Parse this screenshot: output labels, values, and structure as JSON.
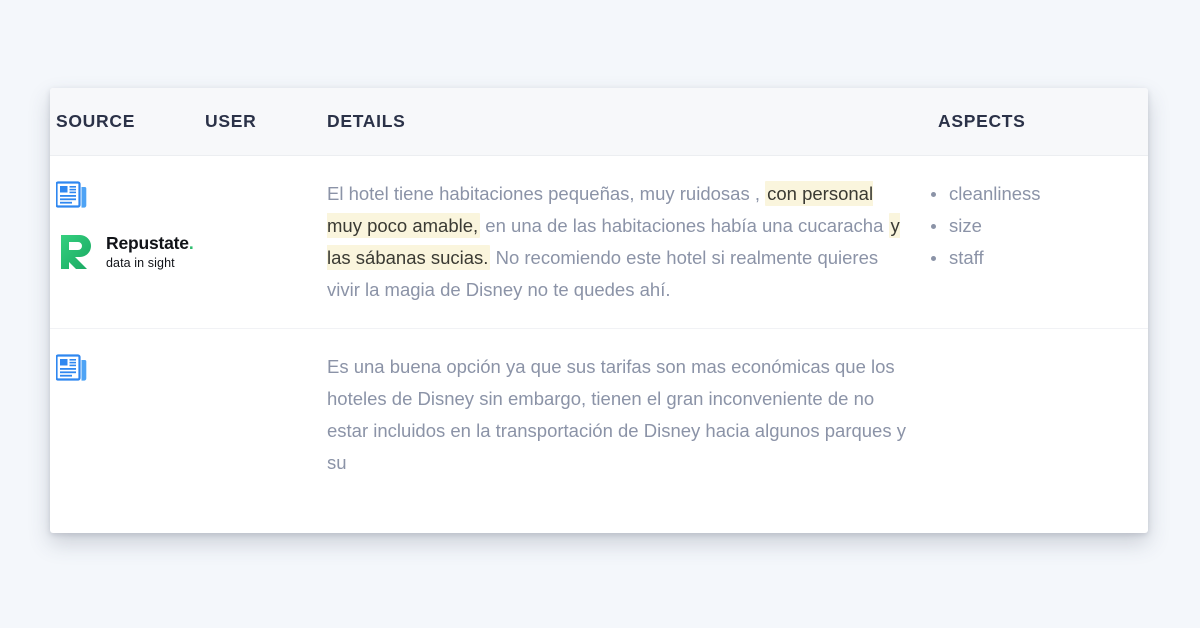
{
  "page": {
    "background_color": "#f4f7fb",
    "card_background": "#ffffff"
  },
  "table": {
    "headers": {
      "source": "SOURCE",
      "user": "USER",
      "details": "DETAILS",
      "aspects": "ASPECTS"
    },
    "header_background": "#f7f8fa",
    "header_text_color": "#2b3248",
    "body_text_color": "#8b93a7",
    "highlight_background": "#faf5dd",
    "highlight_text_color": "#3a3a33",
    "rows": [
      {
        "source_icon": "news-article-icon",
        "source_icon_color": "#2f87f0",
        "details": {
          "segments": [
            {
              "text": "El hotel tiene habitaciones pequeñas, muy ruidosas , ",
              "highlight": false
            },
            {
              "text": "con personal muy poco amable,",
              "highlight": true
            },
            {
              "text": " en una de las habitaciones había una cucaracha ",
              "highlight": false
            },
            {
              "text": "y las sábanas sucias.",
              "highlight": true
            },
            {
              "text": " No recomiendo este hotel si realmente quieres vivir la magia de Disney no te quedes ahí.",
              "highlight": false
            }
          ]
        },
        "aspects": [
          "cleanliness",
          "size",
          "staff"
        ],
        "logo": {
          "name": "Repustate",
          "dot": ".",
          "tagline": "data in sight",
          "mark_color": "#2fbd6f",
          "word_color": "#111318"
        }
      },
      {
        "source_icon": "news-article-icon",
        "source_icon_color": "#2f87f0",
        "details": {
          "segments": [
            {
              "text": "Es una buena opción ya que sus tarifas son mas económicas que los hoteles de Disney sin embargo, tienen el gran inconveniente de no estar incluidos en la transportación de Disney hacia algunos parques y su",
              "highlight": false
            }
          ]
        },
        "aspects": []
      }
    ]
  }
}
